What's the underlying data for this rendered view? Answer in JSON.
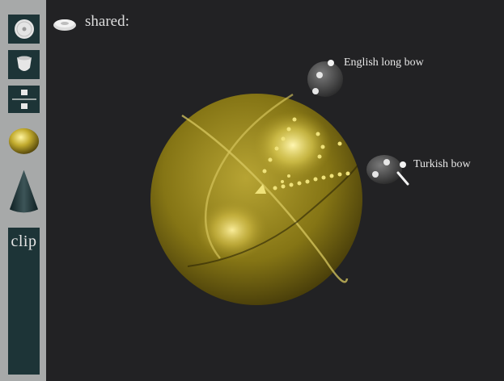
{
  "header": {
    "label": "shared:",
    "icon": "disc-icon"
  },
  "toolbar": {
    "tools": [
      {
        "name": "disc-tool",
        "icon": "disc-icon"
      },
      {
        "name": "cup-tool",
        "icon": "cup-icon"
      },
      {
        "name": "points-tool",
        "icon": "points-icon"
      },
      {
        "name": "sphere-tool",
        "icon": "sphere-icon"
      },
      {
        "name": "cone-tool",
        "icon": "cone-icon"
      }
    ],
    "clip_label": "clip"
  },
  "scene": {
    "sphere_color": "#c9b84a",
    "highlight_color": "#fff3a0",
    "annotations": [
      {
        "label": "English long bow"
      },
      {
        "label": "Turkish bow"
      }
    ]
  },
  "colors": {
    "background": "#222224",
    "toolbar": "#a7a9a9",
    "tool_dark": "#1d3437",
    "point_color": "#e8de6a"
  }
}
